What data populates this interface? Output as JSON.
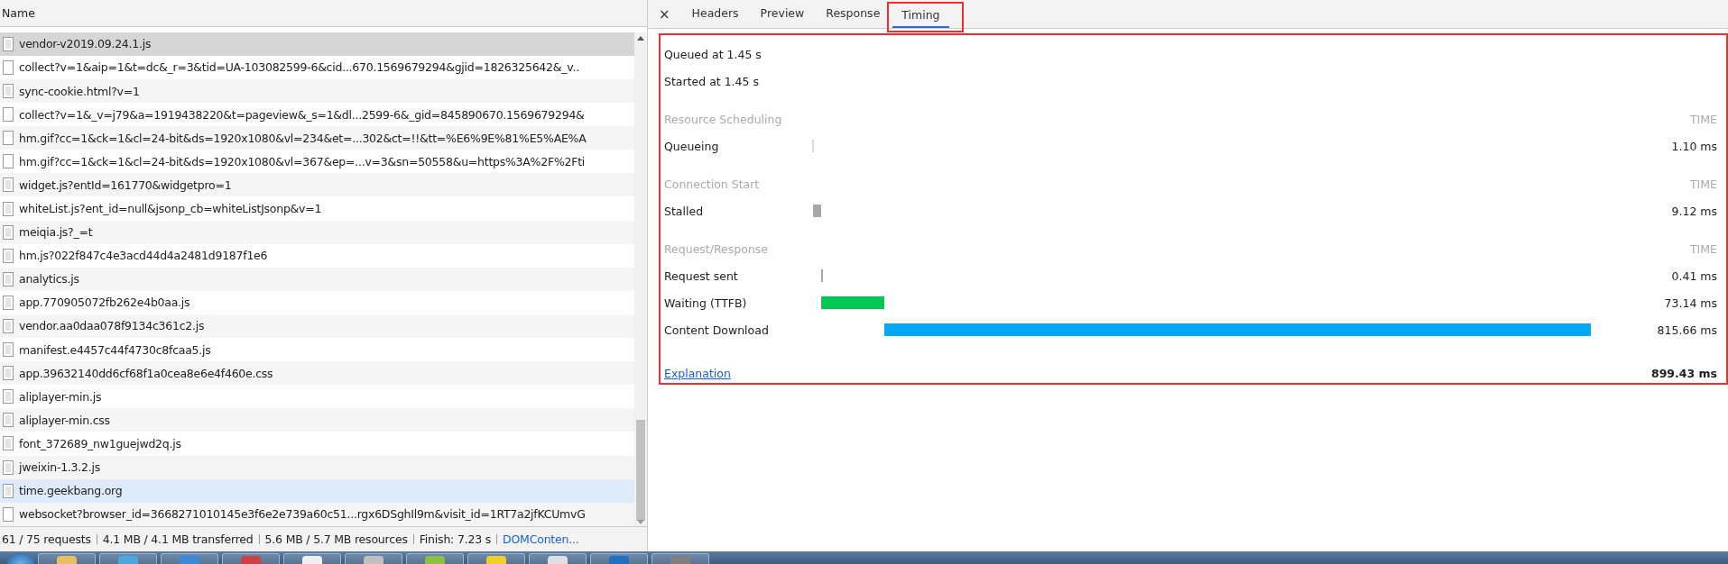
{
  "requests": {
    "column": "Name",
    "rows": [
      {
        "name": "vendor-v2019.09.24.1.js",
        "kind": "document",
        "selected": true,
        "hovered": false
      },
      {
        "name": "collect?v=1&aip=1&t=dc&_r=3&tid=UA-103082599-6&cid...670.1569679294&gjid=1826325642&_v..",
        "kind": "blank",
        "selected": false,
        "hovered": false
      },
      {
        "name": "sync-cookie.html?v=1",
        "kind": "document",
        "selected": false,
        "hovered": false
      },
      {
        "name": "collect?v=1&_v=j79&a=1919438220&t=pageview&_s=1&dl...2599-6&_gid=845890670.1569679294&",
        "kind": "blank",
        "selected": false,
        "hovered": false
      },
      {
        "name": "hm.gif?cc=1&ck=1&cl=24-bit&ds=1920x1080&vl=234&et=...302&ct=!!&tt=%E6%9E%81%E5%AE%A",
        "kind": "blank",
        "selected": false,
        "hovered": false
      },
      {
        "name": "hm.gif?cc=1&ck=1&cl=24-bit&ds=1920x1080&vl=367&ep=...v=3&sn=50558&u=https%3A%2F%2Fti",
        "kind": "blank",
        "selected": false,
        "hovered": false
      },
      {
        "name": "widget.js?entId=161770&widgetpro=1",
        "kind": "document",
        "selected": false,
        "hovered": false
      },
      {
        "name": "whiteList.js?ent_id=null&jsonp_cb=whiteListJsonp&v=1",
        "kind": "document",
        "selected": false,
        "hovered": false
      },
      {
        "name": "meiqia.js?_=t",
        "kind": "document",
        "selected": false,
        "hovered": false
      },
      {
        "name": "hm.js?022f847c4e3acd44d4a2481d9187f1e6",
        "kind": "document",
        "selected": false,
        "hovered": false
      },
      {
        "name": "analytics.js",
        "kind": "document",
        "selected": false,
        "hovered": false
      },
      {
        "name": "app.770905072fb262e4b0aa.js",
        "kind": "document",
        "selected": false,
        "hovered": false
      },
      {
        "name": "vendor.aa0daa078f9134c361c2.js",
        "kind": "document",
        "selected": false,
        "hovered": false
      },
      {
        "name": "manifest.e4457c44f4730c8fcaa5.js",
        "kind": "document",
        "selected": false,
        "hovered": false
      },
      {
        "name": "app.39632140dd6cf68f1a0cea8e6e4f460e.css",
        "kind": "document",
        "selected": false,
        "hovered": false
      },
      {
        "name": "aliplayer-min.js",
        "kind": "document",
        "selected": false,
        "hovered": false
      },
      {
        "name": "aliplayer-min.css",
        "kind": "document",
        "selected": false,
        "hovered": false
      },
      {
        "name": "font_372689_nw1guejwd2q.js",
        "kind": "document",
        "selected": false,
        "hovered": false
      },
      {
        "name": "jweixin-1.3.2.js",
        "kind": "document",
        "selected": false,
        "hovered": false
      },
      {
        "name": "time.geekbang.org",
        "kind": "document",
        "selected": false,
        "hovered": true
      },
      {
        "name": "websocket?browser_id=3668271010145e3f6e2e739a60c51...rgx6DSghIl9m&visit_id=1RT7a2jfKCUmvG",
        "kind": "blank",
        "selected": false,
        "hovered": false
      }
    ]
  },
  "status_bar": {
    "items": [
      "61 / 75 requests",
      "4.1 MB / 4.1 MB transferred",
      "5.6 MB / 5.7 MB resources",
      "Finish: 7.23 s"
    ],
    "link": "DOMConten..."
  },
  "detail": {
    "close": "×",
    "tabs": [
      {
        "label": "Headers",
        "selected": false
      },
      {
        "label": "Preview",
        "selected": false
      },
      {
        "label": "Response",
        "selected": false
      },
      {
        "label": "Timing",
        "selected": true
      }
    ],
    "queued": "Queued at 1.45 s",
    "started": "Started at 1.45 s",
    "sections": [
      {
        "title": "Resource Scheduling",
        "time_heading": "TIME",
        "phases": [
          {
            "label": "Queueing",
            "duration": "1.10 ms",
            "color": "#dcdcdc"
          }
        ]
      },
      {
        "title": "Connection Start",
        "time_heading": "TIME",
        "phases": [
          {
            "label": "Stalled",
            "duration": "9.12 ms",
            "color": "#a8a8a8"
          }
        ]
      },
      {
        "title": "Request/Response",
        "time_heading": "TIME",
        "phases": [
          {
            "label": "Request sent",
            "duration": "0.41 ms",
            "color": "#a8a8a8"
          },
          {
            "label": "Waiting (TTFB)",
            "duration": "73.14 ms",
            "color": "#00c853"
          },
          {
            "label": "Content Download",
            "duration": "815.66 ms",
            "color": "#03a9f4"
          }
        ]
      }
    ],
    "explanation": "Explanation",
    "total": "899.43 ms"
  }
}
